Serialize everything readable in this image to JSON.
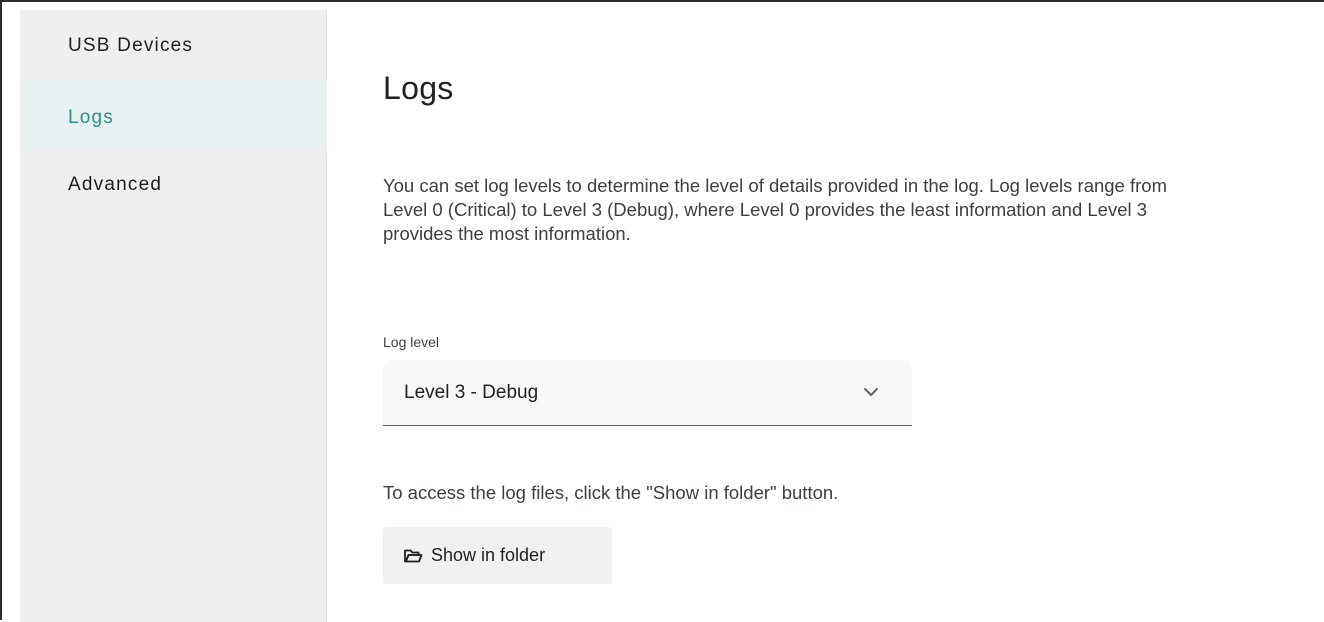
{
  "sidebar": {
    "items": [
      {
        "label": "USB Devices",
        "active": false
      },
      {
        "label": "Logs",
        "active": true
      },
      {
        "label": "Advanced",
        "active": false
      }
    ]
  },
  "main": {
    "title": "Logs",
    "description": "You can set log levels to determine the level of details provided in the log. Log levels range from Level 0 (Critical) to Level 3 (Debug), where Level 0 provides the least information and Level 3 provides the most information.",
    "log_level": {
      "label": "Log level",
      "value": "Level 3 - Debug"
    },
    "instructions": "To access the log files, click the \"Show in folder\" button.",
    "show_folder_label": "Show in folder"
  },
  "colors": {
    "accent": "#2f8f8c",
    "active_bg": "#e9f2f3",
    "sidebar_bg": "#efefef"
  },
  "icons": {
    "select": "chevron-down-icon",
    "button": "folder-open-icon"
  }
}
